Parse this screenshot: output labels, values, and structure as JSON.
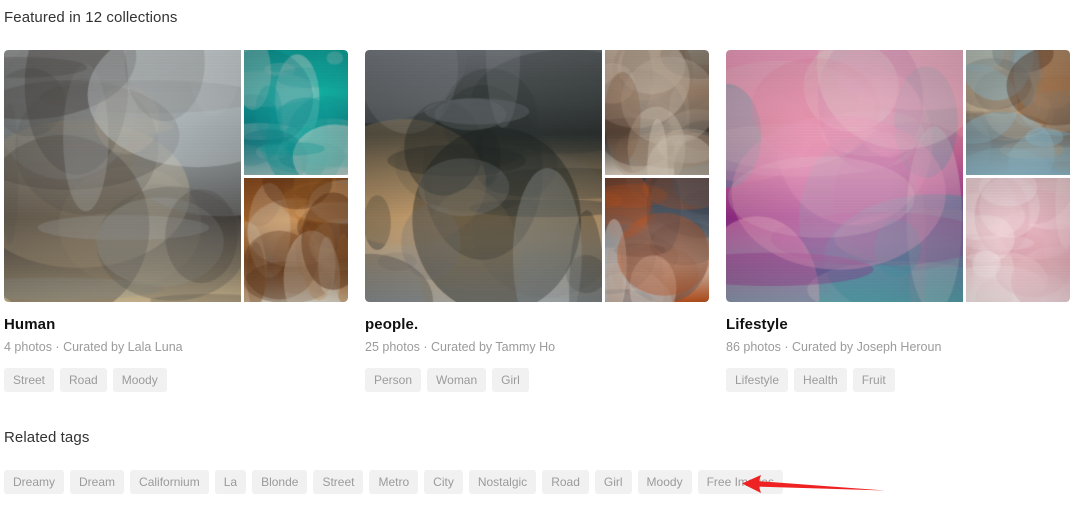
{
  "header": {
    "featured_heading": "Featured in 12 collections"
  },
  "collections": [
    {
      "title": "Human",
      "meta": "4 photos · Curated by Lala Luna",
      "photo_count": "4 photos",
      "curator": "Lala Luna",
      "tags": [
        "Street",
        "Road",
        "Moody"
      ],
      "images": [
        {
          "name": "woman-walking-street-main",
          "alt": "Woman with long ombre hair walking across a street",
          "palette": [
            "#cfd6d8",
            "#9aa3a6",
            "#46403c",
            "#d8c39a",
            "#5a5a58"
          ]
        },
        {
          "name": "aerial-turquoise-boats",
          "alt": "Aerial view of turquoise water with boats on a dock",
          "palette": [
            "#10a09a",
            "#14b3a6",
            "#0e7f86",
            "#d9d9d4"
          ]
        },
        {
          "name": "child-in-autumn-leaves",
          "alt": "Child wrapped in scarf among brown autumn leaves",
          "palette": [
            "#8a4d22",
            "#c07a34",
            "#5a2f14",
            "#e0d8c8"
          ]
        }
      ]
    },
    {
      "title": "people.",
      "meta": "25 photos · Curated by Tammy Ho",
      "photo_count": "25 photos",
      "curator": "Tammy Ho",
      "tags": [
        "Person",
        "Woman",
        "Girl"
      ],
      "images": [
        {
          "name": "woman-on-car-snow-mountains",
          "alt": "Woman in beanie leaning on a car roof rack in snowy mountains",
          "palette": [
            "#6e7378",
            "#2e3433",
            "#c9a271",
            "#aeb4b6",
            "#1d2220"
          ]
        },
        {
          "name": "woman-street-sunset",
          "alt": "Woman with long hair on a sunlit street with parked cars",
          "palette": [
            "#cdbfae",
            "#8d6a4f",
            "#3a322c",
            "#e3d8c8"
          ]
        },
        {
          "name": "woman-white-dress-night-beach",
          "alt": "Woman in white dress standing in shallow water at dusk",
          "palette": [
            "#2b3440",
            "#56606d",
            "#e8e4dd",
            "#c4561f"
          ]
        }
      ]
    },
    {
      "title": "Lifestyle",
      "meta": "86 photos · Curated by Joseph Heroun",
      "photo_count": "86 photos",
      "curator": "Joseph Heroun",
      "tags": [
        "Lifestyle",
        "Health",
        "Fruit"
      ],
      "images": [
        {
          "name": "birds-pink-sunset-beach",
          "alt": "Birds flying over a pink sunset sky above the ocean with a person on the beach",
          "palette": [
            "#f0a0c0",
            "#e98aa8",
            "#9b2f8e",
            "#3f9aa8",
            "#e8e0d8"
          ]
        },
        {
          "name": "woman-hat-pouring-sand",
          "alt": "Woman in straw hat pouring sand through her hands at sunset",
          "palette": [
            "#f1c79a",
            "#d9a06a",
            "#5c3a25",
            "#8fb9c9"
          ]
        },
        {
          "name": "woman-portrait-soft-pink",
          "alt": "Soft pink washed portrait of a woman",
          "palette": [
            "#f3dede",
            "#e7b8c2",
            "#d79ba6",
            "#fbf3f4"
          ]
        }
      ]
    }
  ],
  "related": {
    "heading": "Related tags",
    "tags": [
      "Dreamy",
      "Dream",
      "Californium",
      "La",
      "Blonde",
      "Street",
      "Metro",
      "City",
      "Nostalgic",
      "Road",
      "Girl",
      "Moody",
      "Free Images"
    ]
  },
  "annotation": {
    "name": "red-arrow-pointing-left",
    "color": "#ee2222",
    "points_to": "Free Images"
  },
  "colors": {
    "chip_bg": "#f1f1f1",
    "chip_text": "#9b9b9b",
    "title_text": "#111111",
    "meta_text": "#9b9b9b",
    "heading_text": "#333333",
    "arrow": "#ee2222"
  }
}
